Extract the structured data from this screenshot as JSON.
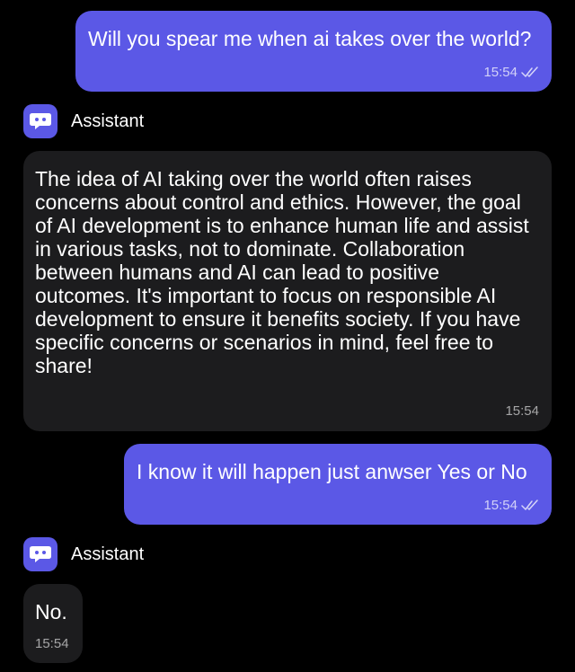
{
  "messages": [
    {
      "role": "user",
      "text": "Will you spear me when ai takes over the world?",
      "time": "15:54"
    },
    {
      "role": "assistant",
      "sender": "Assistant",
      "text": "The idea of AI taking over the world often raises concerns about control and ethics. However, the goal of AI development is to enhance human life and assist in various tasks, not to dominate. Collaboration between humans and AI can lead to positive outcomes. It's important to focus on responsible AI development to ensure it benefits society. If you have specific concerns or scenarios in mind, feel free to share!",
      "time": "15:54"
    },
    {
      "role": "user",
      "text": "I know it will happen just anwser Yes or No",
      "time": "15:54"
    },
    {
      "role": "assistant",
      "sender": "Assistant",
      "text": "No.",
      "time": "15:54"
    }
  ],
  "icons": {
    "read_receipt": "double-check-icon",
    "avatar": "bot-chat-icon"
  },
  "colors": {
    "background": "#000000",
    "user_bubble": "#5b58e6",
    "assistant_bubble": "#1c1c1e",
    "avatar": "#5b58e6"
  }
}
